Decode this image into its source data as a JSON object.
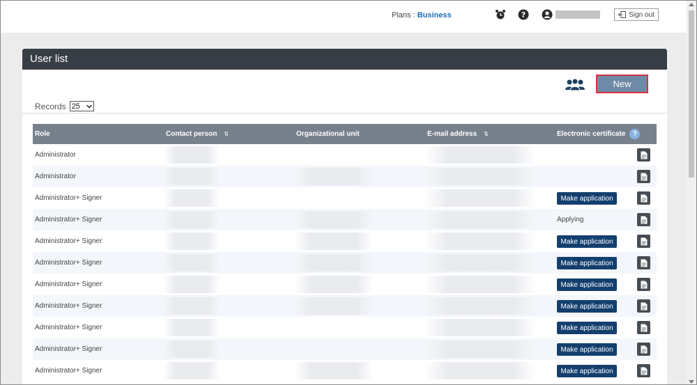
{
  "header": {
    "plans_label": "Plans : ",
    "plan_name": "Business",
    "signout_label": "Sign out",
    "icons": [
      "alarm-clock-icon",
      "help-icon",
      "user-icon"
    ]
  },
  "panel": {
    "title": "User list",
    "new_button": "New",
    "records_label": "Records",
    "records_value": "25"
  },
  "table": {
    "columns": [
      "Role",
      "Contact person",
      "Organizational unit",
      "E-mail address",
      "Electronic certificate"
    ],
    "rows": [
      {
        "role": "Administrator",
        "cert": ""
      },
      {
        "role": "Administrator",
        "cert": ""
      },
      {
        "role": "Administrator+ Signer",
        "cert": "Make application"
      },
      {
        "role": "Administrator+ Signer",
        "cert": "Applying"
      },
      {
        "role": "Administrator+ Signer",
        "cert": "Make application"
      },
      {
        "role": "Administrator+ Signer",
        "cert": "Make application"
      },
      {
        "role": "Administrator+ Signer",
        "cert": "Make application"
      },
      {
        "role": "Administrator+ Signer",
        "cert": "Make application"
      },
      {
        "role": "Administrator+ Signer",
        "cert": "Make application"
      },
      {
        "role": "Administrator+ Signer",
        "cert": "Make application"
      },
      {
        "role": "Administrator+ Signer",
        "cert": "Make application"
      }
    ]
  },
  "colors": {
    "panel_header": "#383e45",
    "table_header": "#77818c",
    "primary_button": "#133f6e",
    "new_button": "#6e8aa6",
    "highlight_border": "#d9323a",
    "plan_link": "#1e6fb5"
  }
}
